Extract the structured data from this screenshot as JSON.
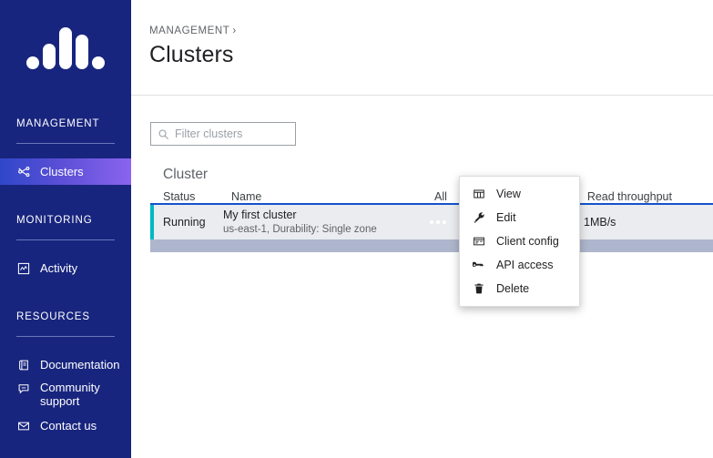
{
  "brand": {
    "logo_name": "waveform-logo",
    "sidebar_bg": "#18257e",
    "active_gradient_from": "#2f47c9",
    "active_gradient_to": "#8a64ee"
  },
  "sidebar": {
    "sections": [
      {
        "label": "MANAGEMENT",
        "items": [
          {
            "label": "Clusters",
            "icon": "cluster-nodes-icon",
            "active": true
          }
        ]
      },
      {
        "label": "MONITORING",
        "items": [
          {
            "label": "Activity",
            "icon": "activity-chart-icon",
            "active": false
          }
        ]
      },
      {
        "label": "RESOURCES",
        "items": [
          {
            "label": "Documentation",
            "icon": "documentation-book-icon",
            "active": false
          },
          {
            "label": "Community support",
            "icon": "chat-bubble-icon",
            "active": false
          },
          {
            "label": "Contact us",
            "icon": "envelope-icon",
            "active": false
          }
        ]
      }
    ]
  },
  "header": {
    "breadcrumb": "MANAGEMENT",
    "breadcrumb_separator": "›",
    "title": "Clusters"
  },
  "search": {
    "placeholder": "Filter clusters",
    "value": "",
    "icon": "search-icon"
  },
  "table": {
    "group_header": "Cluster",
    "columns": {
      "status": "Status",
      "name": "Name",
      "allocation": "All",
      "read_throughput": "Read throughput"
    },
    "rows": [
      {
        "status": "Running",
        "name": "My first cluster",
        "detail": "us-east-1, Durability: Single zone",
        "read_throughput": "1MB/s",
        "status_color": "#00b8c4",
        "kebab_icon": "more-options-icon"
      }
    ]
  },
  "context_menu": {
    "items": [
      {
        "label": "View",
        "icon": "table-view-icon"
      },
      {
        "label": "Edit",
        "icon": "wrench-icon"
      },
      {
        "label": "Client config",
        "icon": "client-config-icon"
      },
      {
        "label": "API access",
        "icon": "key-icon"
      },
      {
        "label": "Delete",
        "icon": "trash-icon"
      }
    ]
  }
}
